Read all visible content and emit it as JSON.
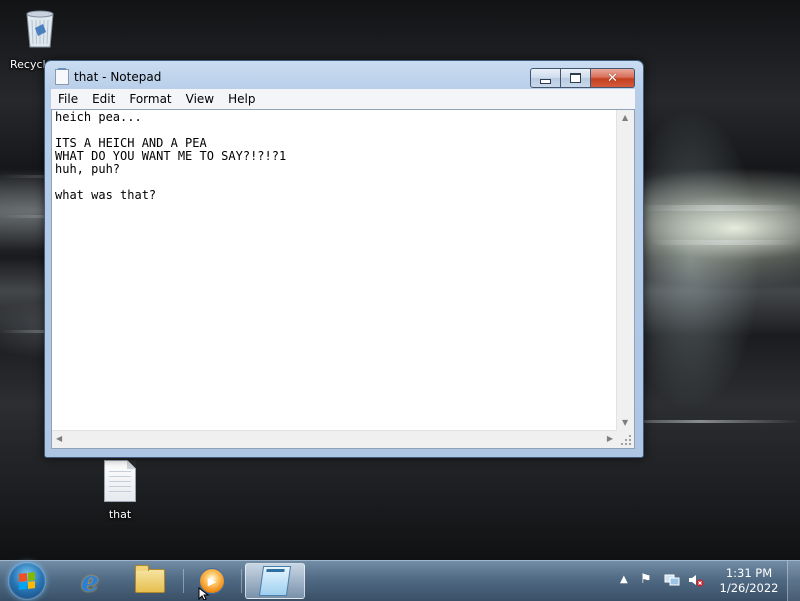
{
  "desktop": {
    "icons": {
      "recycle_bin_label": "Recycle",
      "file_label": "that"
    }
  },
  "window": {
    "title": "that - Notepad",
    "menu": [
      "File",
      "Edit",
      "Format",
      "View",
      "Help"
    ],
    "content": "heich pea...\n\nITS A HEICH AND A PEA\nWHAT DO YOU WANT ME TO SAY?!?!?1\nhuh, puh?\n\nwhat was that?",
    "close_glyph": "✕"
  },
  "taskbar": {
    "pinned": [
      "internet-explorer",
      "windows-explorer",
      "windows-media-player",
      "notepad"
    ],
    "active": "notepad"
  },
  "tray": {
    "time": "1:31 PM",
    "date": "1/26/2022",
    "icons": [
      "show-hidden-icons-arrow",
      "action-center-flag",
      "network",
      "volume-muted"
    ]
  },
  "colors": {
    "titlebar": "#b7cde8",
    "close_button": "#c4401f",
    "taskbar": "#5a7896"
  }
}
